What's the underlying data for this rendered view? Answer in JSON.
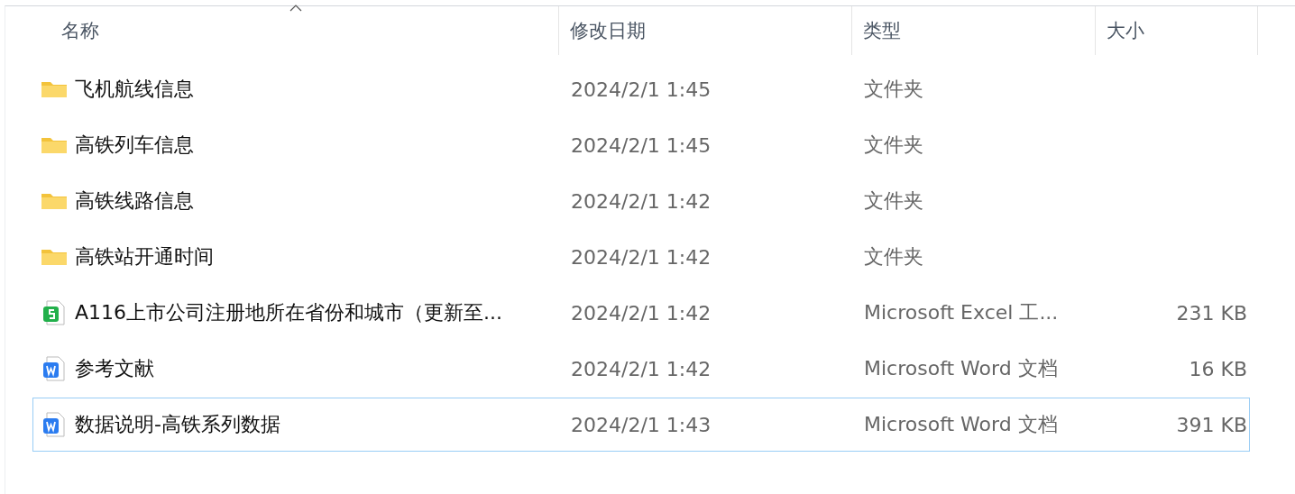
{
  "columns": [
    {
      "label": "名称",
      "sorted": true
    },
    {
      "label": "修改日期",
      "sorted": false
    },
    {
      "label": "类型",
      "sorted": false
    },
    {
      "label": "大小",
      "sorted": false
    }
  ],
  "rows": [
    {
      "kind": "folder",
      "name": "飞机航线信息",
      "date": "2024/2/1 1:45",
      "type": "文件夹",
      "focused": false
    },
    {
      "kind": "folder",
      "name": "高铁列车信息",
      "date": "2024/2/1 1:45",
      "type": "文件夹",
      "focused": false
    },
    {
      "kind": "folder",
      "name": "高铁线路信息",
      "date": "2024/2/1 1:42",
      "type": "文件夹",
      "focused": false
    },
    {
      "kind": "folder",
      "name": "高铁站开通时间",
      "date": "2024/2/1 1:42",
      "type": "文件夹",
      "focused": false
    },
    {
      "kind": "sheet",
      "name": "A116上市公司注册地所在省份和城市（更新至...",
      "date": "2024/2/1 1:42",
      "type": "Microsoft Excel 工...",
      "size": "231 KB",
      "focused": false
    },
    {
      "kind": "doc",
      "name": "参考文献",
      "date": "2024/2/1 1:42",
      "type": "Microsoft Word 文档",
      "size": "16 KB",
      "focused": false
    },
    {
      "kind": "doc",
      "name": "数据说明-高铁系列数据",
      "date": "2024/2/1 1:43",
      "type": "Microsoft Word 文档",
      "size": "391 KB",
      "focused": true
    }
  ]
}
